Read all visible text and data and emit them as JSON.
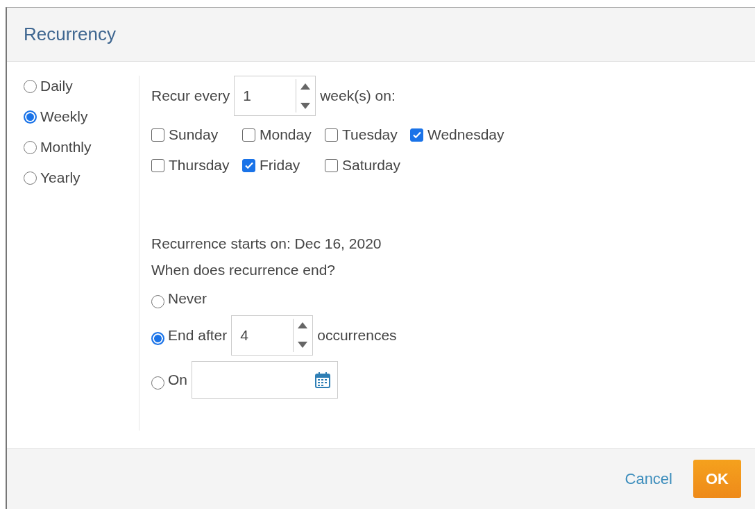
{
  "dialog": {
    "title": "Recurrency"
  },
  "frequency": [
    {
      "label": "Daily",
      "selected": false
    },
    {
      "label": "Weekly",
      "selected": true
    },
    {
      "label": "Monthly",
      "selected": false
    },
    {
      "label": "Yearly",
      "selected": false
    }
  ],
  "recur_every": {
    "prefix": "Recur every",
    "value": "1",
    "suffix": "week(s) on:"
  },
  "days": [
    {
      "label": "Sunday",
      "checked": false
    },
    {
      "label": "Monday",
      "checked": false
    },
    {
      "label": "Tuesday",
      "checked": false
    },
    {
      "label": "Wednesday",
      "checked": true
    },
    {
      "label": "Thursday",
      "checked": false
    },
    {
      "label": "Friday",
      "checked": true
    },
    {
      "label": "Saturday",
      "checked": false
    }
  ],
  "starts_on": "Recurrence starts on: Dec 16, 2020",
  "end_question": "When does recurrence end?",
  "end_options": [
    {
      "kind": "plain",
      "label": "Never",
      "selected": false
    },
    {
      "kind": "count",
      "label": "End after",
      "value": "4",
      "suffix": "occurrences",
      "selected": true
    },
    {
      "kind": "date",
      "label": "On",
      "selected": false
    }
  ],
  "buttons": [
    {
      "kind": "link",
      "label": "Cancel"
    },
    {
      "kind": "primary",
      "label": "OK"
    }
  ]
}
